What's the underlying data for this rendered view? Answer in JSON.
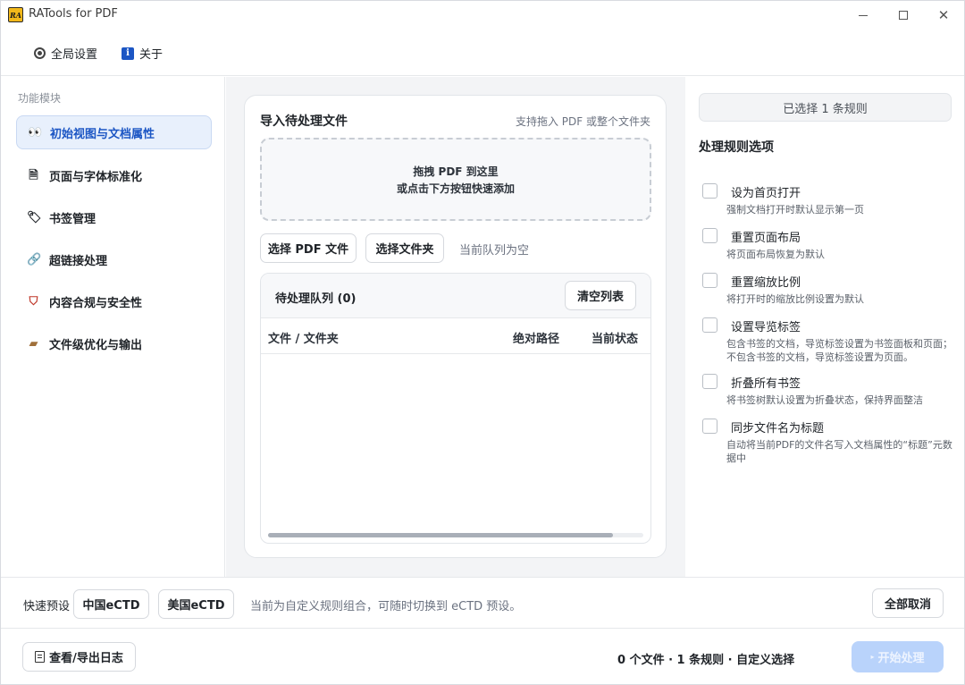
{
  "window": {
    "title": "RATools for PDF",
    "logo_text": "RA"
  },
  "menu": {
    "global_settings": "全局设置",
    "about": "关于"
  },
  "sidebar": {
    "title": "功能模块",
    "items": [
      {
        "label": "初始视图与文档属性",
        "icon": "eyes-icon",
        "active": true
      },
      {
        "label": "页面与字体标准化",
        "icon": "page-icon",
        "active": false
      },
      {
        "label": "书签管理",
        "icon": "tag-icon",
        "active": false
      },
      {
        "label": "超链接处理",
        "icon": "link-icon",
        "active": false
      },
      {
        "label": "内容合规与安全性",
        "icon": "shield-icon",
        "active": false
      },
      {
        "label": "文件级优化与输出",
        "icon": "box-icon",
        "active": false
      }
    ]
  },
  "import": {
    "title": "导入待处理文件",
    "hint": "支持拖入 PDF 或整个文件夹",
    "drop_line1": "拖拽 PDF 到这里",
    "drop_line2": "或点击下方按钮快速添加",
    "select_pdf": "选择 PDF 文件",
    "select_folder": "选择文件夹",
    "queue_status": "当前队列为空",
    "queue_title": "待处理队列 (0)",
    "clear_list": "清空列表",
    "columns": [
      "文件 / 文件夹",
      "绝对路径",
      "当前状态"
    ]
  },
  "rules": {
    "selected": "已选择 1 条规则",
    "title": "处理规则选项",
    "items": [
      {
        "label": "设为首页打开",
        "desc": "强制文档打开时默认显示第一页",
        "checked": false
      },
      {
        "label": "重置页面布局",
        "desc": "将页面布局恢复为默认",
        "checked": false
      },
      {
        "label": "重置缩放比例",
        "desc": "将打开时的缩放比例设置为默认",
        "checked": false
      },
      {
        "label": "设置导览标签",
        "desc": "包含书签的文档，导览标签设置为书签面板和页面；不包含书签的文档，导览标签设置为页面。",
        "checked": false
      },
      {
        "label": "折叠所有书签",
        "desc": "将书签树默认设置为折叠状态，保持界面整洁",
        "checked": false
      },
      {
        "label": "同步文件名为标题",
        "desc": "自动将当前PDF的文件名写入文档属性的“标题”元数据中",
        "checked": false
      }
    ]
  },
  "presets": {
    "label": "快速预设",
    "china": "中国eCTD",
    "us": "美国eCTD",
    "hint": "当前为自定义规则组合，可随时切换到 eCTD 预设。",
    "cancel_all": "全部取消"
  },
  "footer": {
    "log": "查看/导出日志",
    "summary": "0 个文件 · 1 条规则 · 自定义选择",
    "start": "开始处理"
  },
  "colors": {
    "accent": "#1c56c4",
    "active_bg": "#e8f0fc",
    "start_disabled": "#b9d3fb"
  }
}
